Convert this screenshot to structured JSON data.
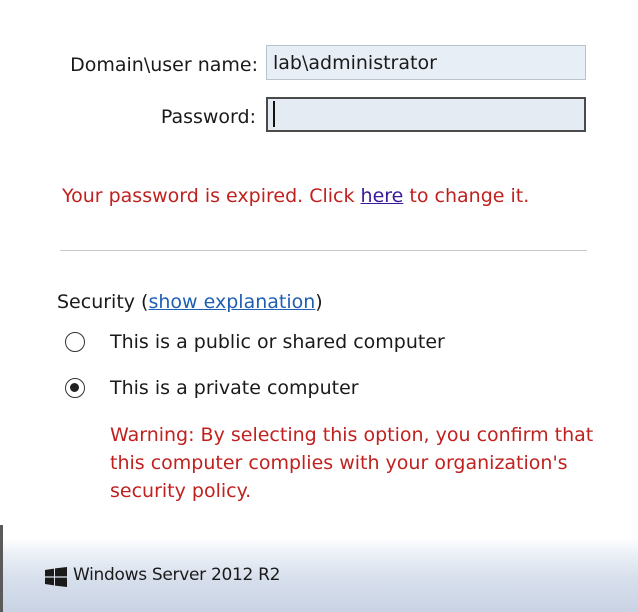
{
  "form": {
    "username_label": "Domain\\user name:",
    "username_value": "lab\\administrator",
    "password_label": "Password:",
    "password_value": ""
  },
  "error": {
    "prefix": "Your password is expired. Click ",
    "link": "here",
    "suffix": " to change it."
  },
  "security": {
    "label": "Security (",
    "link": "show explanation",
    "close": ")",
    "options": [
      {
        "label": "This is a public or shared computer",
        "selected": false
      },
      {
        "label": "This is a private computer",
        "selected": true
      }
    ],
    "warning": "Warning: By selecting this option, you confirm that this computer complies with your organization's security policy."
  },
  "footer": {
    "brand": "Windows Server 2012 R2",
    "logo_icon": "windows-logo-icon"
  },
  "colors": {
    "error": "#c0211f",
    "link": "#1f5fb3",
    "visited_link": "#3a1a9a"
  }
}
